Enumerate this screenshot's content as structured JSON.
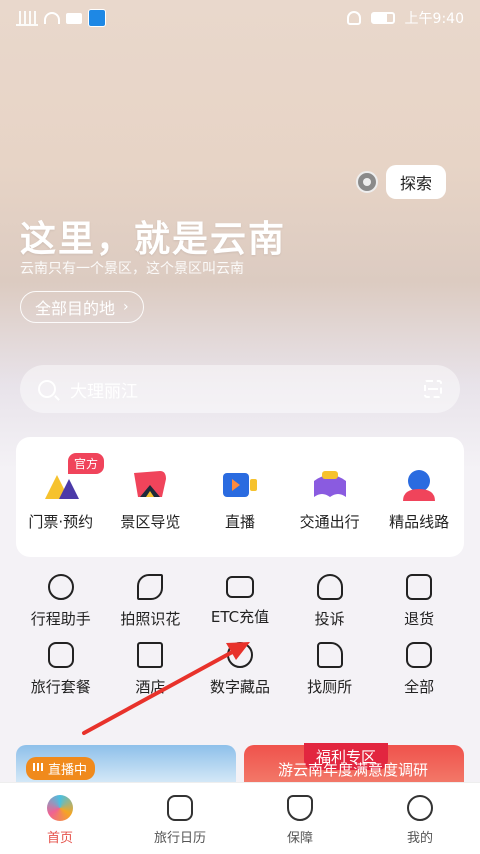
{
  "status": {
    "time": "上午9:40"
  },
  "explore": {
    "label": "探索"
  },
  "hero": {
    "slogan": "这里，就是云南",
    "subtitle": "云南只有一个景区，这个景区叫云南",
    "all_destinations": "全部目的地"
  },
  "search": {
    "placeholder": "大理丽江"
  },
  "categories": [
    {
      "label": "门票·预约",
      "badge": "官方",
      "icon": "ticket-icon"
    },
    {
      "label": "景区导览",
      "icon": "scenic-guide-icon"
    },
    {
      "label": "直播",
      "icon": "live-camera-icon"
    },
    {
      "label": "交通出行",
      "icon": "transport-icon"
    },
    {
      "label": "精品线路",
      "icon": "route-icon"
    }
  ],
  "services": [
    [
      {
        "label": "行程助手",
        "icon": "location-pin-icon"
      },
      {
        "label": "拍照识花",
        "icon": "flower-icon"
      },
      {
        "label": "ETC充值",
        "icon": "etc-card-icon"
      },
      {
        "label": "投诉",
        "icon": "complaint-cloud-icon"
      },
      {
        "label": "退货",
        "icon": "return-icon"
      }
    ],
    [
      {
        "label": "旅行套餐",
        "icon": "luggage-icon"
      },
      {
        "label": "酒店",
        "icon": "hotel-icon"
      },
      {
        "label": "数字藏品",
        "icon": "digital-collection-icon"
      },
      {
        "label": "找厕所",
        "icon": "toilet-icon"
      },
      {
        "label": "全部",
        "icon": "more-dots-icon"
      }
    ]
  ],
  "cards": {
    "live_badge": "直播中",
    "welfare_badge": "福利专区",
    "welfare_text": "游云南年度满意度调研"
  },
  "tabbar": [
    {
      "label": "首页",
      "active": true
    },
    {
      "label": "旅行日历"
    },
    {
      "label": "保障"
    },
    {
      "label": "我的"
    }
  ],
  "colors": {
    "accent": "#e5534b",
    "arrow": "#e8322b"
  }
}
